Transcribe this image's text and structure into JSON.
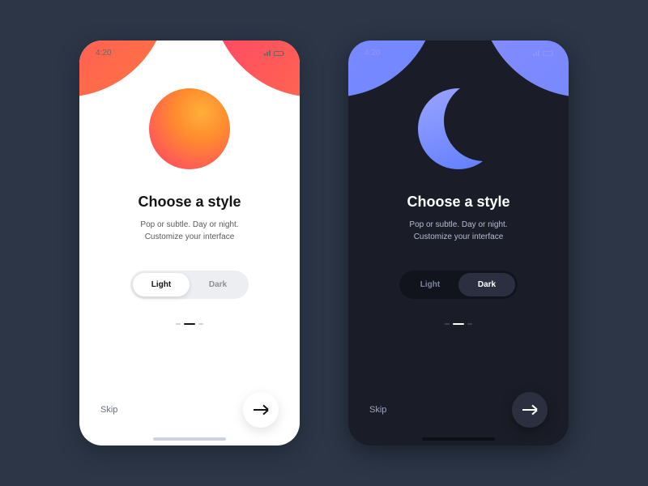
{
  "status": {
    "time": "4:20"
  },
  "heading": "Choose a style",
  "subtitle": "Pop or subtle. Day or night.\nCustomize your interface",
  "toggle": {
    "light": "Light",
    "dark": "Dark"
  },
  "footer": {
    "skip": "Skip"
  },
  "screens": {
    "light": {
      "selected": "light"
    },
    "dark": {
      "selected": "dark"
    }
  }
}
